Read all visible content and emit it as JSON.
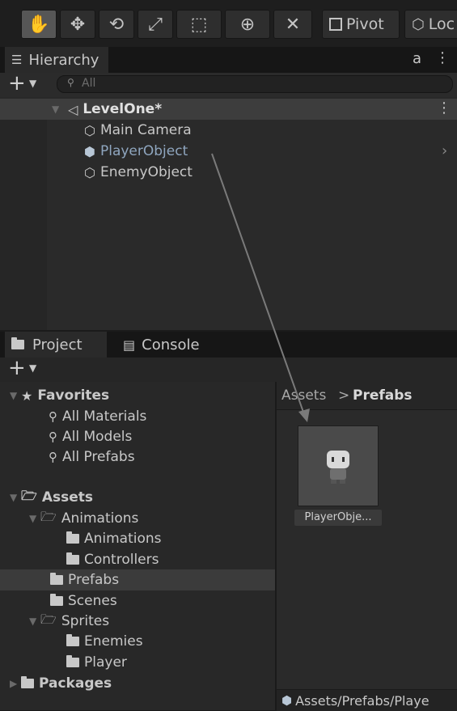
{
  "toolbar": {
    "tools": [
      {
        "name": "hand-tool-button",
        "glyph": "✋"
      },
      {
        "name": "move-tool-button",
        "glyph": "✥"
      },
      {
        "name": "rotate-tool-button",
        "glyph": "⟲"
      },
      {
        "name": "scale-tool-button",
        "glyph": "⤢"
      },
      {
        "name": "rect-tool-button",
        "glyph": "⬚"
      },
      {
        "name": "transform-tool-button",
        "glyph": "⊕"
      },
      {
        "name": "custom-tool-button",
        "glyph": "✕"
      }
    ],
    "pivot_label": "Pivot",
    "local_label": "Loc"
  },
  "hierarchy": {
    "tab_label": "Hierarchy",
    "search_placeholder": "All",
    "scene_name": "LevelOne*",
    "items": [
      "Main Camera",
      "PlayerObject",
      "EnemyObject"
    ]
  },
  "project": {
    "tab_label": "Project",
    "console_label": "Console",
    "favorites_label": "Favorites",
    "favorites": [
      "All Materials",
      "All Models",
      "All Prefabs"
    ],
    "assets_label": "Assets",
    "animations_label": "Animations",
    "animations_children": [
      "Animations",
      "Controllers"
    ],
    "prefabs_label": "Prefabs",
    "scenes_label": "Scenes",
    "sprites_label": "Sprites",
    "sprites_children": [
      "Enemies",
      "Player"
    ],
    "packages_label": "Packages",
    "breadcrumb_root": "Assets",
    "breadcrumb_sep": ">",
    "breadcrumb_current": "Prefabs",
    "asset_tile_label": "PlayerObje...",
    "footer_path": "Assets/Prefabs/Playe"
  },
  "colors": {
    "panel": "#292929",
    "selection": "#3b3b3b",
    "drag_arrow": "#7a7a7a"
  }
}
